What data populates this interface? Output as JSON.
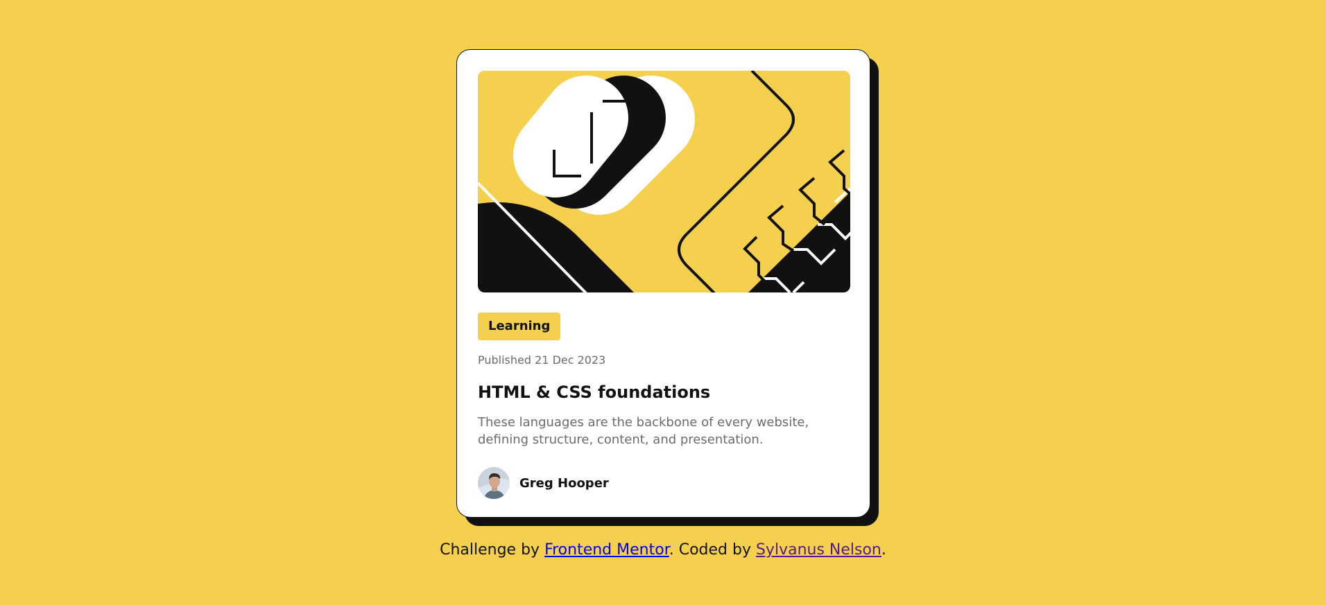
{
  "card": {
    "tag": "Learning",
    "published": "Published 21 Dec 2023",
    "title": "HTML & CSS foundations",
    "description": "These languages are the backbone of every website, defining structure, content, and presentation.",
    "author_name": "Greg Hooper",
    "illustration_icon": "geometric-illustration",
    "avatar_icon": "author-avatar"
  },
  "attribution": {
    "prefix": "Challenge by ",
    "link1": "Frontend Mentor",
    "middle": ". Coded by ",
    "link2": "Sylvanus Nelson",
    "suffix": "."
  },
  "colors": {
    "background": "#F4D04E",
    "card": "#FFFFFF",
    "ink": "#111111",
    "muted": "#6B6B6B",
    "link": "#0000EE",
    "visited_link": "#551A8B"
  }
}
